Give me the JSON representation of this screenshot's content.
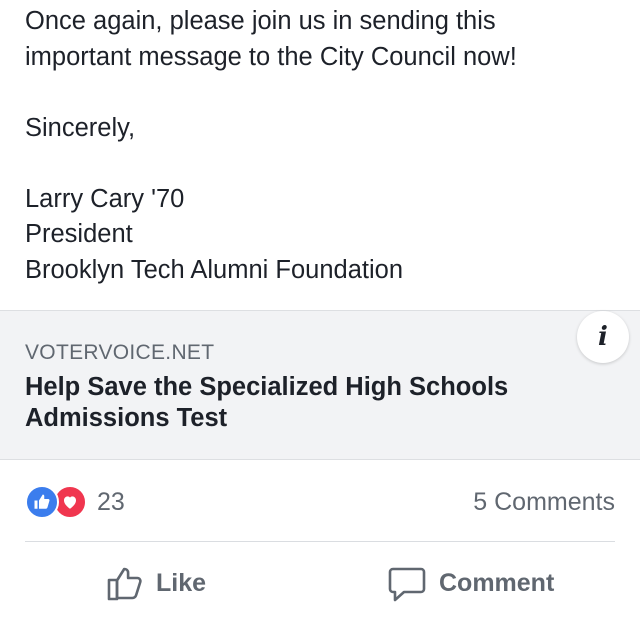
{
  "post": {
    "lines": {
      "l1": "Once again, please join us in sending this",
      "l2": "important message to the City Council now!",
      "l3": "Sincerely,",
      "l4": "Larry Cary '70",
      "l5": "President",
      "l6": "Brooklyn Tech Alumni Foundation"
    }
  },
  "link_card": {
    "domain": "VOTERVOICE.NET",
    "title": "Help Save the Specialized High Schools Admissions Test",
    "info_icon": "i"
  },
  "stats": {
    "reaction_count": "23",
    "comments": "5 Comments",
    "reaction_icons": [
      "like-icon",
      "love-icon"
    ]
  },
  "actions": {
    "like": "Like",
    "comment": "Comment"
  },
  "colors": {
    "like_blue": "#3b7ded",
    "love_red": "#f0364f",
    "muted_text": "#606770",
    "card_bg": "#f2f3f5"
  }
}
